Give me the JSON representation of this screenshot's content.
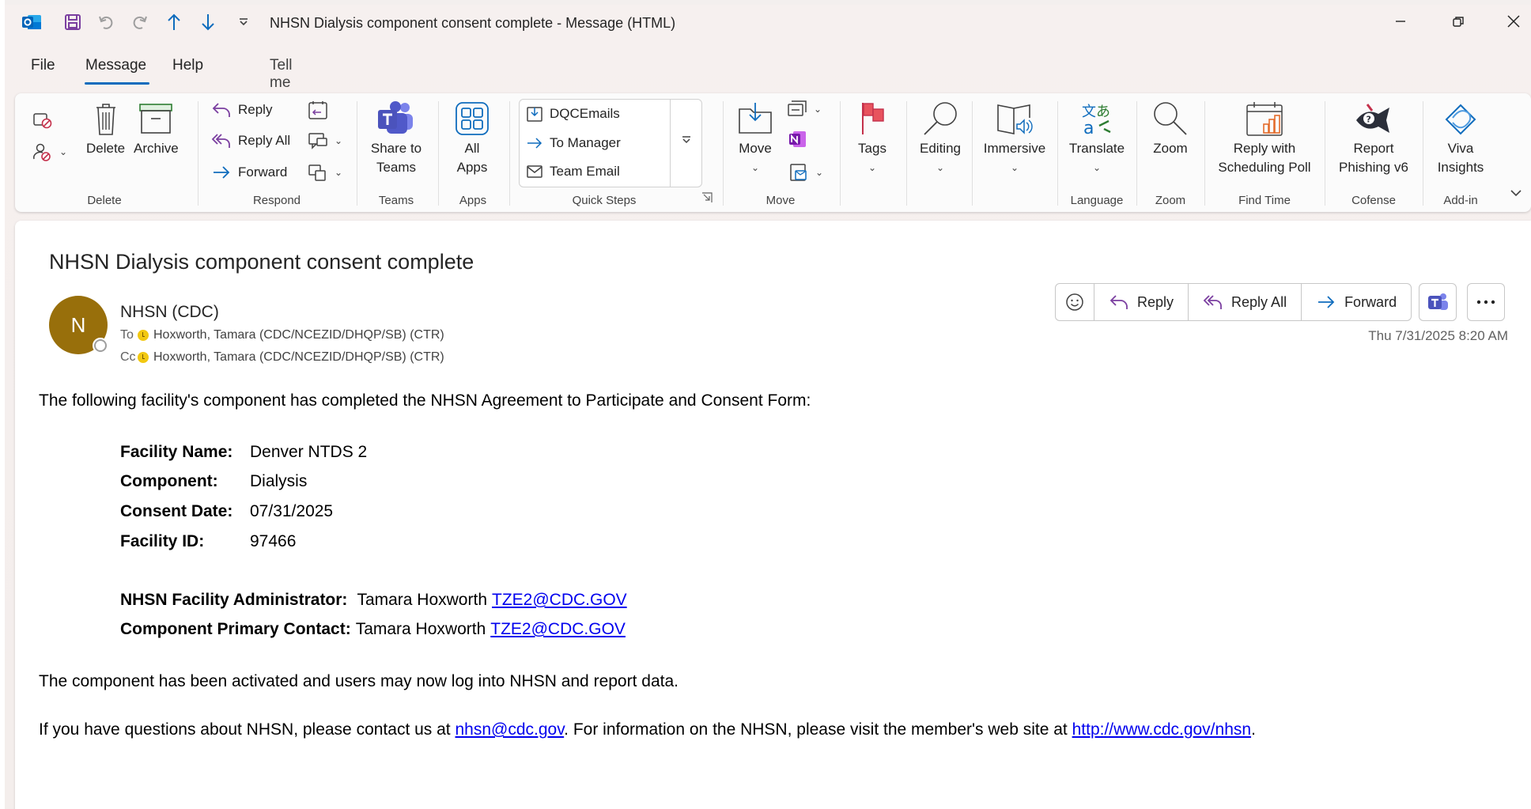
{
  "window": {
    "title": "NHSN Dialysis component consent complete  -  Message (HTML)"
  },
  "menu": {
    "tabs": [
      "File",
      "Message",
      "Help"
    ],
    "active": "Message",
    "tell_me": "Tell me what you want to do"
  },
  "ribbon": {
    "delete_group": {
      "label": "Delete",
      "delete": "Delete",
      "archive": "Archive"
    },
    "respond_group": {
      "label": "Respond",
      "reply": "Reply",
      "reply_all": "Reply All",
      "forward": "Forward"
    },
    "teams_group": {
      "label": "Teams",
      "share_line1": "Share to",
      "share_line2": "Teams"
    },
    "apps_group": {
      "label": "Apps",
      "line1": "All",
      "line2": "Apps"
    },
    "quick_steps": {
      "label": "Quick Steps",
      "items": [
        "DQCEmails",
        "To Manager",
        "Team Email"
      ]
    },
    "move_group": {
      "label": "Move",
      "move": "Move"
    },
    "tags": "Tags",
    "editing": "Editing",
    "immersive": "Immersive",
    "language_group": {
      "label": "Language",
      "translate": "Translate"
    },
    "zoom_group": {
      "label": "Zoom",
      "zoom": "Zoom"
    },
    "findtime_group": {
      "label": "Find Time",
      "line1": "Reply with",
      "line2": "Scheduling Poll"
    },
    "cofense_group": {
      "label": "Cofense",
      "line1": "Report",
      "line2": "Phishing v6"
    },
    "addin_group": {
      "label": "Add-in",
      "line1": "Viva",
      "line2": "Insights"
    }
  },
  "message": {
    "subject": "NHSN Dialysis component consent complete",
    "avatar_initial": "N",
    "sender": "NHSN (CDC)",
    "to_label": "To",
    "to": "Hoxworth, Tamara (CDC/NCEZID/DHQP/SB) (CTR)",
    "cc_label": "Cc",
    "cc": "Hoxworth, Tamara (CDC/NCEZID/DHQP/SB) (CTR)",
    "date": "Thu 7/31/2025 8:20 AM",
    "actions": {
      "reply": "Reply",
      "reply_all": "Reply All",
      "forward": "Forward"
    }
  },
  "body": {
    "intro": "The following facility's component has completed the NHSN Agreement to Participate and Consent Form:",
    "facility_name_label": "Facility Name:",
    "facility_name": "Denver NTDS 2",
    "component_label": "Component:",
    "component": "Dialysis",
    "consent_date_label": "Consent Date:",
    "consent_date": "07/31/2025",
    "facility_id_label": "Facility ID:",
    "facility_id": "97466",
    "admin_label": "NHSN Facility Administrator:",
    "admin_name": "Tamara Hoxworth",
    "admin_email": "TZE2@CDC.GOV",
    "contact_label": "Component Primary Contact:",
    "contact_name": "Tamara Hoxworth",
    "contact_email": "TZE2@CDC.GOV",
    "activated": "The component has been activated and users may now log into NHSN and report data.",
    "questions_pre": "If you have questions about NHSN, please contact us at ",
    "questions_email": "nhsn@cdc.gov",
    "questions_mid": ". For information on the NHSN, please visit the member's web site at ",
    "questions_url": "http://www.cdc.gov/nhsn",
    "questions_end": "."
  }
}
